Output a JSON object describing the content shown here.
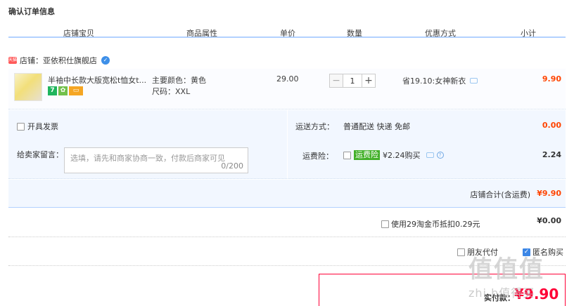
{
  "page": {
    "title": "确认订单信息"
  },
  "columns": [
    "店铺宝贝",
    "商品属性",
    "单价",
    "数量",
    "优惠方式",
    "小计"
  ],
  "shop": {
    "badge": "天猫",
    "label": "店铺：亚依积仕旗舰店"
  },
  "item": {
    "title": "半袖中长款大版宽松t恤女t...",
    "color": "主要颜色：黄色",
    "size": "尺码：XXL",
    "price": "29.00",
    "quantity": "1",
    "minus": "−",
    "plus": "+",
    "promo": "省19.10:女神新衣",
    "subtotal": "9.90",
    "service_icons": [
      "seven-day-return-icon",
      "flower-icon",
      "card-icon"
    ]
  },
  "options": {
    "invoice_label": "开具发票",
    "ship_label": "运送方式：",
    "ship_value": "普通配送 快递 免邮",
    "ship_price": "0.00",
    "message_label": "给卖家留言：",
    "message_placeholder": "选填，请先和商家协商一致，付款后商家可见",
    "message_count": "0/200",
    "insurance_label": "运费险：",
    "insurance_tag": "运费险",
    "insurance_text": "¥2.24购买",
    "insurance_price": "2.24"
  },
  "shop_total": {
    "label": "店铺合计(含运费)",
    "value": "¥9.90"
  },
  "coins": {
    "label": "使用29淘金币抵扣0.29元",
    "value": "¥0.00"
  },
  "buyer": {
    "friend_pay": "朋友代付",
    "anonymous": "匿名购买",
    "anonymous_checked": true
  },
  "payment": {
    "label": "实付款：",
    "value": "¥9.90"
  },
  "watermark": {
    "logo": "值值值",
    "text": "zhi.h值得买"
  },
  "colors": {
    "accent": "#ff4400",
    "pay_red": "#ff0036",
    "header_border": "#b2d1ff",
    "panel_bg": "#f2f7ff"
  }
}
